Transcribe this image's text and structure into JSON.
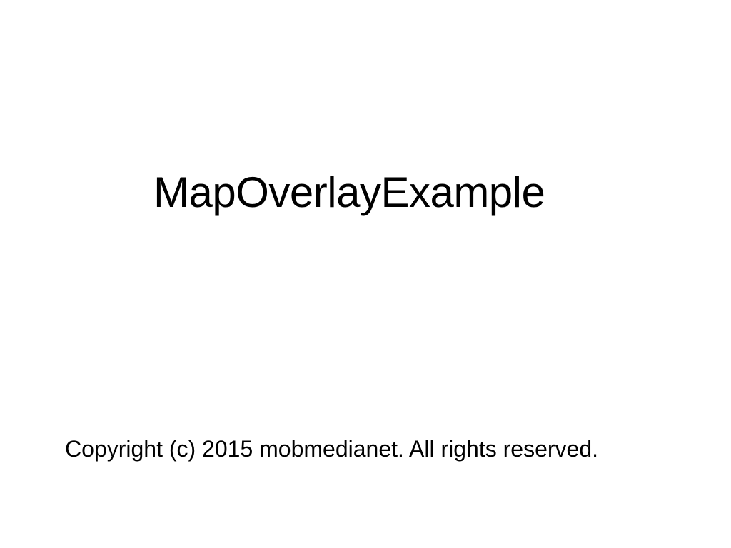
{
  "splash": {
    "title": "MapOverlayExample",
    "copyright": "Copyright (c) 2015 mobmedianet. All rights reserved."
  },
  "colors": {
    "background": "#ffffff",
    "text": "#000000"
  }
}
